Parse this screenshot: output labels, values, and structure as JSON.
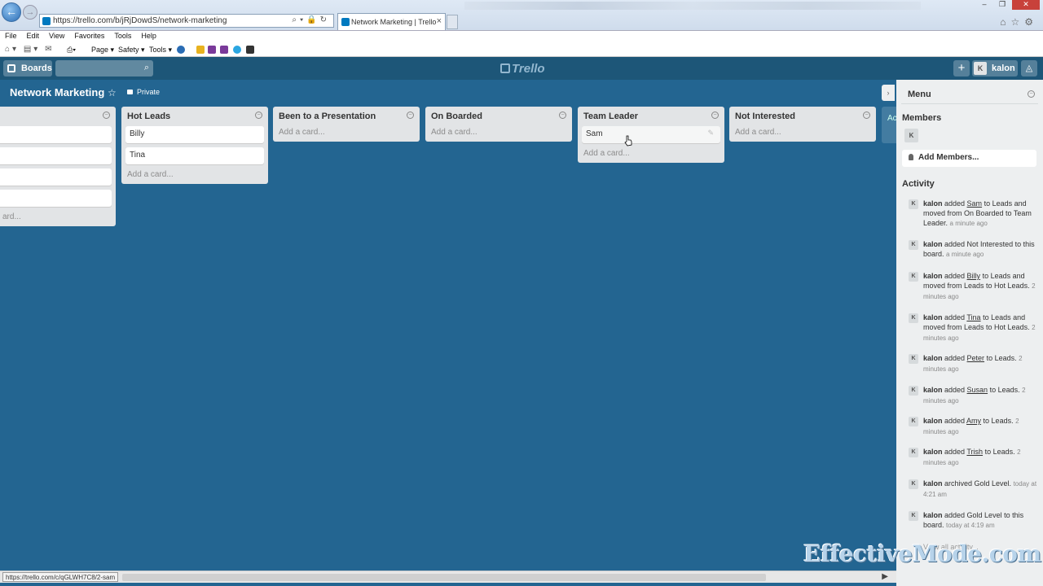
{
  "browser": {
    "url": "https://trello.com/b/jRjDowdS/network-marketing",
    "tab_title": "Network Marketing | Trello",
    "menu": [
      "File",
      "Edit",
      "View",
      "Favorites",
      "Tools",
      "Help"
    ],
    "cmd": {
      "page": "Page ▾",
      "safety": "Safety ▾",
      "tools": "Tools ▾"
    },
    "status_url": "https://trello.com/c/qGLWH7C8/2-sam"
  },
  "header": {
    "boards_label": "Boards",
    "logo": "Trello",
    "user": "kalon",
    "avatar_initial": "K",
    "plus": "+",
    "bell": "♫"
  },
  "board": {
    "title": "Network Marketing",
    "privacy": "Private",
    "star": "☆",
    "add_card_label": "Add a card...",
    "partial_add_label": "ard...",
    "lists": [
      {
        "title": "",
        "cards": [
          "",
          "",
          "",
          ""
        ]
      },
      {
        "title": "Hot Leads",
        "cards": [
          "Billy",
          "Tina"
        ]
      },
      {
        "title": "Been to a Presentation",
        "cards": []
      },
      {
        "title": "On Boarded",
        "cards": []
      },
      {
        "title": "Team Leader",
        "cards": [
          "Sam"
        ]
      },
      {
        "title": "Not Interested",
        "cards": []
      }
    ],
    "peek_label": "Ac"
  },
  "panel": {
    "title": "Menu",
    "members_heading": "Members",
    "member_initial": "K",
    "add_members": "Add Members...",
    "activity_heading": "Activity",
    "view_all": "View all activity...",
    "activity": [
      {
        "user": "kalon",
        "pre": " added ",
        "link": "Sam",
        "post": " to Leads and moved from On Boarded to Team Leader.",
        "time": "a minute ago"
      },
      {
        "user": "kalon",
        "pre": " added Not Interested to this board.",
        "link": "",
        "post": "",
        "time": "a minute ago"
      },
      {
        "user": "kalon",
        "pre": " added ",
        "link": "Billy",
        "post": " to Leads and moved from Leads to Hot Leads.",
        "time": "2 minutes ago"
      },
      {
        "user": "kalon",
        "pre": " added ",
        "link": "Tina",
        "post": " to Leads and moved from Leads to Hot Leads.",
        "time": "2 minutes ago"
      },
      {
        "user": "kalon",
        "pre": " added ",
        "link": "Peter",
        "post": " to Leads.",
        "time": "2 minutes ago"
      },
      {
        "user": "kalon",
        "pre": " added ",
        "link": "Susan",
        "post": " to Leads.",
        "time": "2 minutes ago"
      },
      {
        "user": "kalon",
        "pre": " added ",
        "link": "Amy",
        "post": " to Leads.",
        "time": "2 minutes ago"
      },
      {
        "user": "kalon",
        "pre": " added ",
        "link": "Trish",
        "post": " to Leads.",
        "time": "2 minutes ago"
      },
      {
        "user": "kalon",
        "pre": " archived Gold Level.",
        "link": "",
        "post": "",
        "time": "today at 4:21 am"
      },
      {
        "user": "kalon",
        "pre": " added Gold Level to this board.",
        "link": "",
        "post": "",
        "time": "today at 4:19 am"
      }
    ]
  },
  "watermark": "EffectiveMode.com",
  "colors": {
    "board_bg": "#236591",
    "header_bg": "#1d5678",
    "list_bg": "#e2e4e6",
    "panel_bg": "#edeff0"
  }
}
